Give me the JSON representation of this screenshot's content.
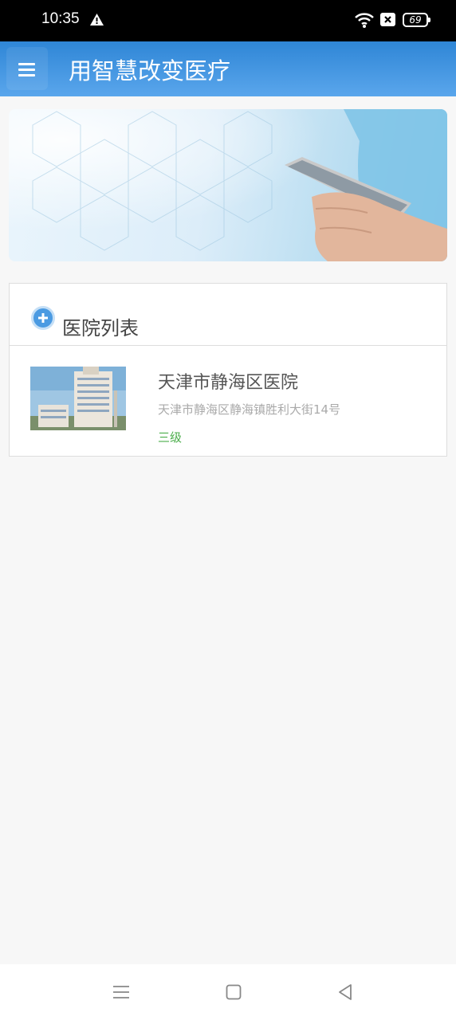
{
  "status_bar": {
    "time": "10:35",
    "battery": "69",
    "icons": [
      "warning-icon",
      "wifi-icon",
      "no-sim-icon",
      "battery-icon"
    ]
  },
  "app_bar": {
    "menu_icon": "menu-icon",
    "title": "用智慧改变医疗",
    "color": "#3b8fdc"
  },
  "list": {
    "title": "医院列表",
    "icon": "plus-circle-icon",
    "items": [
      {
        "name": "天津市静海区医院",
        "address": "天津市静海区静海镇胜利大街14号",
        "level": "三级"
      }
    ]
  },
  "nav_bar": {
    "icons": [
      "menu-icon",
      "home-icon",
      "back-icon"
    ]
  }
}
